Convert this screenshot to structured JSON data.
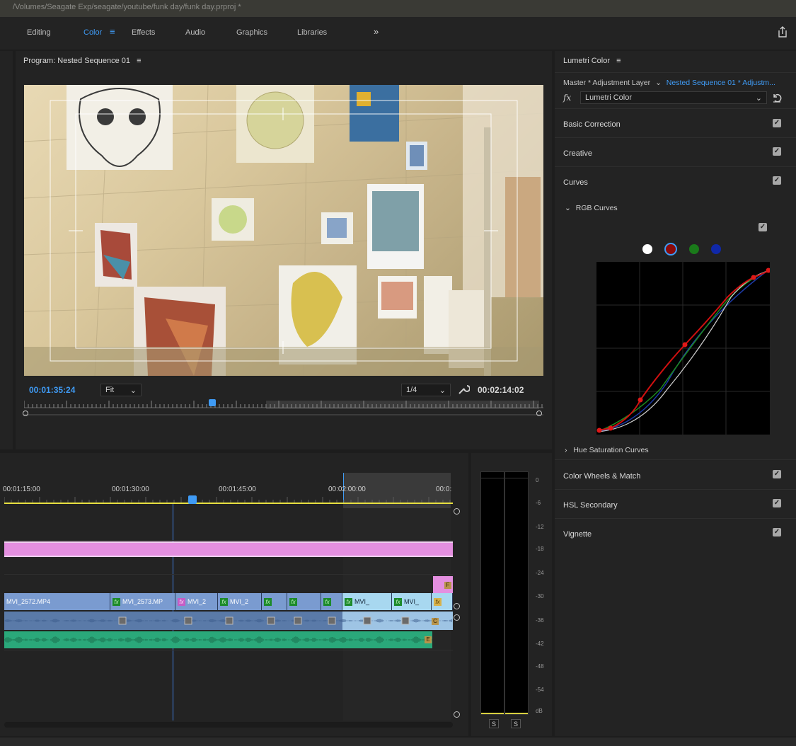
{
  "window": {
    "title": "/Volumes/Seagate Exp/seagate/youtube/funk day/funk day.prproj *"
  },
  "workspaces": [
    {
      "label": "Editing"
    },
    {
      "label": "Color"
    },
    {
      "label": "Effects"
    },
    {
      "label": "Audio"
    },
    {
      "label": "Graphics"
    },
    {
      "label": "Libraries"
    }
  ],
  "icons": {
    "menu": "≡",
    "more": "»",
    "share": "share-icon"
  },
  "program": {
    "title": "Program: Nested Sequence 01",
    "current_timecode": "00:01:35:24",
    "zoom": "Fit",
    "resolution": "1/4",
    "duration_timecode": "00:02:14:02",
    "playhead_fraction": 0.362
  },
  "lumetri": {
    "title": "Lumetri Color",
    "source_master": "Master * Adjustment Layer",
    "source_clip": "Nested Sequence 01 * Adjustm...",
    "effect": "Lumetri Color",
    "sections": [
      {
        "label": "Basic Correction",
        "checked": true
      },
      {
        "label": "Creative",
        "checked": true
      },
      {
        "label": "Curves",
        "checked": true
      }
    ],
    "rgb_curves_label": "RGB Curves",
    "hue_sat_label": "Hue Saturation Curves",
    "bottom_sections": [
      {
        "label": "Color Wheels & Match",
        "checked": true
      },
      {
        "label": "HSL Secondary",
        "checked": true
      },
      {
        "label": "Vignette",
        "checked": true
      }
    ],
    "channel_colors": [
      "#ffffff",
      "#8b0a0a",
      "#1a7a1a",
      "#1028a8"
    ],
    "selected_channel": "red"
  },
  "timeline": {
    "timecodes": [
      "00:01:15:00",
      "00:01:30:00",
      "00:01:45:00",
      "00:02:00:00",
      "00:0:"
    ],
    "clips_v1": [
      {
        "label": "MVI_2572.MP4"
      },
      {
        "label": "MVI_2573.MP"
      },
      {
        "label": "MVI_2"
      },
      {
        "label": "MVI_2"
      },
      {
        "label": "MVI_"
      },
      {
        "label": "MVI_"
      }
    ],
    "small_labels": {
      "f": "F",
      "c": "C",
      "e": "E"
    }
  },
  "meter": {
    "scale": [
      "0",
      "-6",
      "-12",
      "-18",
      "-24",
      "-30",
      "-36",
      "-42",
      "-48",
      "-54",
      "dB"
    ],
    "solo_left": "S",
    "solo_right": "S"
  }
}
